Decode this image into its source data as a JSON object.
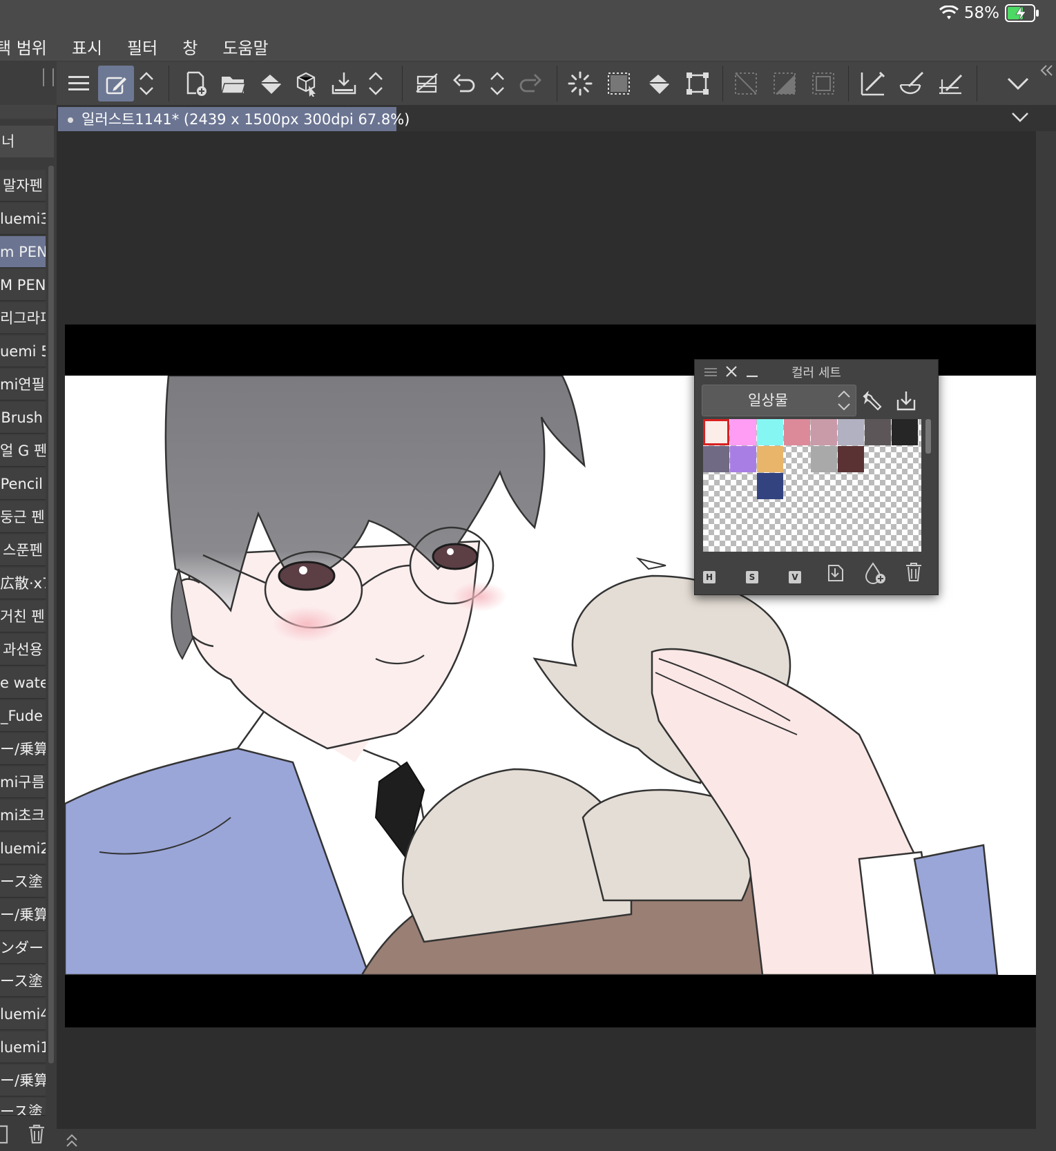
{
  "status": {
    "battery": "58%"
  },
  "menu": [
    "택 범위",
    "표시",
    "필터",
    "창",
    "도움말"
  ],
  "brushes": {
    "header": "너",
    "items": [
      "말자펜",
      "luemi3",
      "m PEN",
      "M PEN",
      "리그라피",
      "uemi 5",
      "mi연필",
      "Brush",
      "얼 G 펜",
      "Pencil",
      "둥근 펜",
      "스푼펜",
      "広散·x7",
      "거친 펜",
      "과선용",
      "e water",
      "_Fude",
      "ー/乗算",
      "mi구름",
      "mi초크",
      "luemi2",
      "ース塗",
      "ー/乗算",
      "ンダー",
      "ース塗",
      "luemi4",
      "luemi1",
      "ー/乗算",
      "ース塗"
    ],
    "selected_index": 2
  },
  "document": {
    "tab_title": "일러스트1141* (2439 x 1500px 300dpi 67.8%)"
  },
  "palette": {
    "title": "컬러 세트",
    "set_name": "일상물",
    "hsv": [
      "H",
      "S",
      "V"
    ],
    "swatches": [
      [
        "#fbeee9",
        "#ff9cf4",
        "#86f6f3",
        "#dc8a99",
        "#c99aa8",
        "#b1b1c1",
        "#5c5659",
        "#262626"
      ],
      [
        "#706a84",
        "#a97ee4",
        "#e8b56a",
        "transparent",
        "#a9a9a9",
        "#5a3234",
        "transparent",
        "transparent"
      ],
      [
        "transparent",
        "transparent",
        "#33437f",
        "transparent",
        "transparent",
        "transparent",
        "transparent",
        "transparent"
      ]
    ]
  },
  "colors": {
    "accent": "#6b7592",
    "hair": "#7c7c80",
    "jacket": "#9aa6d8",
    "skin": "#fdeeee",
    "bread": "#e4ddd5",
    "sleeve_brown": "#9a7f74"
  }
}
